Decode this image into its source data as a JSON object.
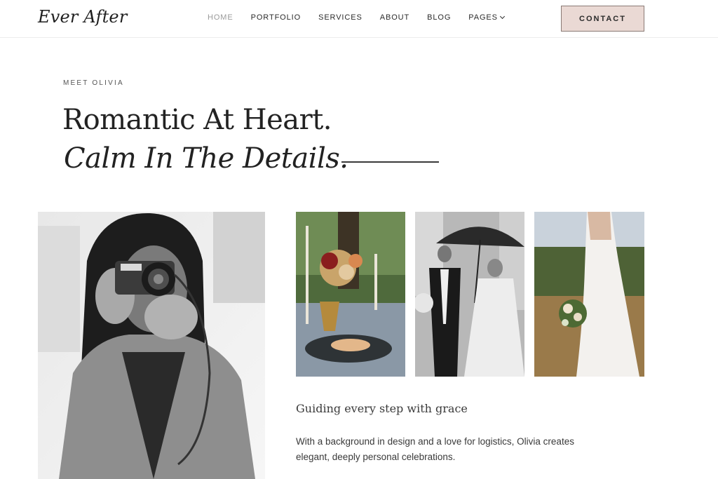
{
  "header": {
    "logo": "Ever After",
    "nav": [
      {
        "label": "HOME",
        "active": true
      },
      {
        "label": "PORTFOLIO",
        "active": false
      },
      {
        "label": "SERVICES",
        "active": false
      },
      {
        "label": "ABOUT",
        "active": false
      },
      {
        "label": "BLOG",
        "active": false
      },
      {
        "label": "PAGES",
        "active": false,
        "dropdown": true
      }
    ],
    "contact_label": "CONTACT"
  },
  "hero": {
    "eyebrow": "MEET OLIVIA",
    "title_line1": "Romantic At Heart.",
    "title_line2": "Calm In The Details."
  },
  "gallery": {
    "main_photo": "woman-with-camera-photo",
    "thumbnails": [
      "table-setting-photo",
      "couple-umbrella-photo",
      "bride-bouquet-photo"
    ]
  },
  "content": {
    "subheading": "Guiding every step with grace",
    "paragraph": "With a background in design and a love for logistics, Olivia creates elegant, deeply personal celebrations."
  },
  "colors": {
    "accent_button_bg": "#ead9d4",
    "nav_active": "#9a9a9a",
    "text": "#2b2b2b"
  }
}
